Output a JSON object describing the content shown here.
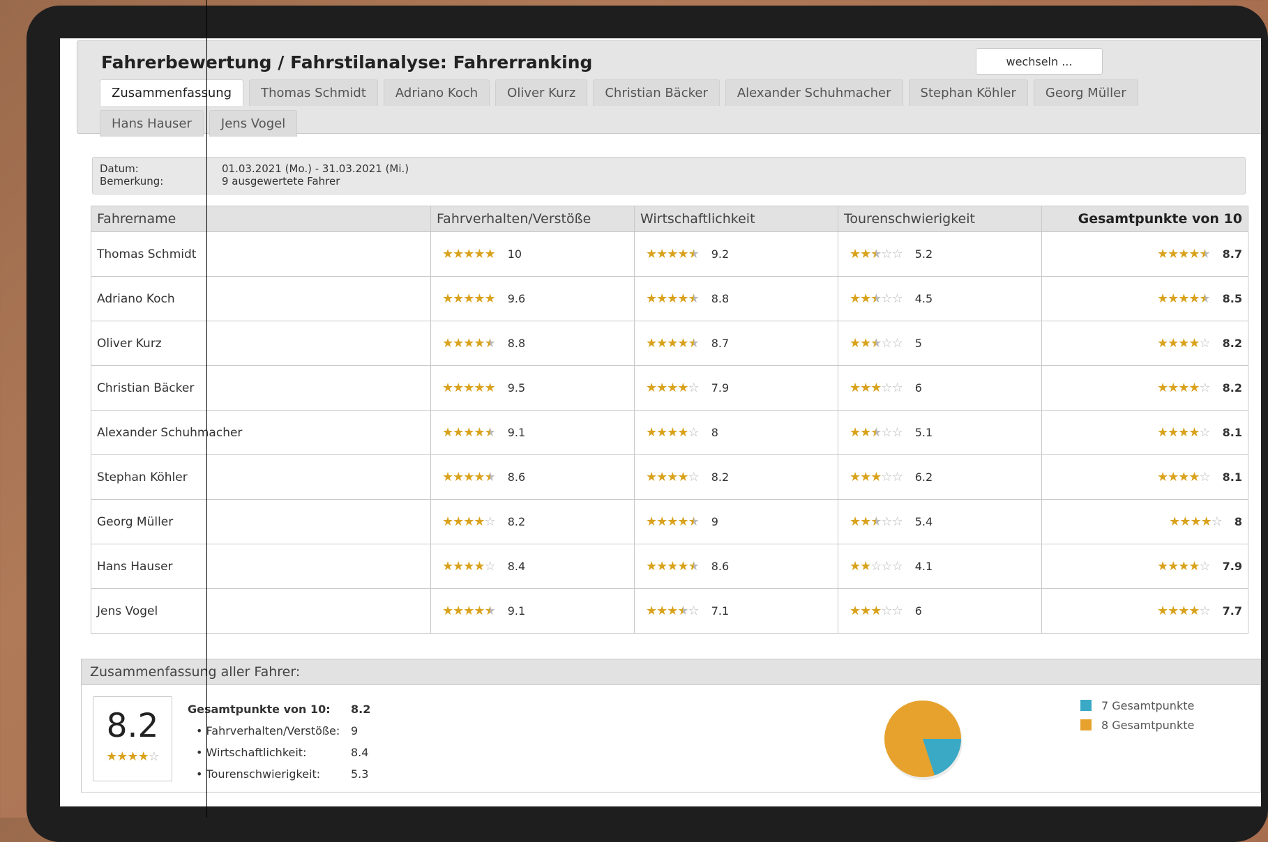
{
  "app": {
    "title": "Fahrerbewertung / Fahrstilanalyse: Fahrerranking",
    "switch_label": "wechseln ..."
  },
  "tabs": [
    {
      "label": "Zusammenfassung",
      "active": true
    },
    {
      "label": "Thomas Schmidt"
    },
    {
      "label": "Adriano Koch"
    },
    {
      "label": "Oliver Kurz"
    },
    {
      "label": "Christian Bäcker"
    },
    {
      "label": "Alexander Schuhmacher"
    },
    {
      "label": "Stephan Köhler"
    },
    {
      "label": "Georg Müller"
    },
    {
      "label": "Hans Hauser"
    },
    {
      "label": "Jens Vogel"
    }
  ],
  "info": {
    "date_label": "Datum:",
    "date_value": "01.03.2021 (Mo.) - 31.03.2021 (Mi.)",
    "note_label": "Bemerkung:",
    "note_value": "9 ausgewertete Fahrer"
  },
  "table": {
    "headers": [
      "Fahrername",
      "Fahrverhalten/Verstöße",
      "Wirtschaftlichkeit",
      "Tourenschwierigkeit",
      "Gesamtpunkte von 10"
    ],
    "rows": [
      {
        "name": "Thomas Schmidt",
        "fahrverhalten": "10",
        "fahrverhalten_stars": 5,
        "wirtschaft": "9.2",
        "wirtschaft_stars": 4.5,
        "touren": "5.2",
        "touren_stars": 2.5,
        "gesamt": "8.7",
        "gesamt_stars": 4.5
      },
      {
        "name": "Adriano Koch",
        "fahrverhalten": "9.6",
        "fahrverhalten_stars": 5,
        "wirtschaft": "8.8",
        "wirtschaft_stars": 4.5,
        "touren": "4.5",
        "touren_stars": 2.5,
        "gesamt": "8.5",
        "gesamt_stars": 4.5
      },
      {
        "name": "Oliver Kurz",
        "fahrverhalten": "8.8",
        "fahrverhalten_stars": 4.5,
        "wirtschaft": "8.7",
        "wirtschaft_stars": 4.5,
        "touren": "5",
        "touren_stars": 2.5,
        "gesamt": "8.2",
        "gesamt_stars": 4
      },
      {
        "name": "Christian Bäcker",
        "fahrverhalten": "9.5",
        "fahrverhalten_stars": 5,
        "wirtschaft": "7.9",
        "wirtschaft_stars": 4,
        "touren": "6",
        "touren_stars": 3,
        "gesamt": "8.2",
        "gesamt_stars": 4
      },
      {
        "name": "Alexander Schuhmacher",
        "fahrverhalten": "9.1",
        "fahrverhalten_stars": 4.5,
        "wirtschaft": "8",
        "wirtschaft_stars": 4,
        "touren": "5.1",
        "touren_stars": 2.5,
        "gesamt": "8.1",
        "gesamt_stars": 4
      },
      {
        "name": "Stephan Köhler",
        "fahrverhalten": "8.6",
        "fahrverhalten_stars": 4.5,
        "wirtschaft": "8.2",
        "wirtschaft_stars": 4,
        "touren": "6.2",
        "touren_stars": 3,
        "gesamt": "8.1",
        "gesamt_stars": 4
      },
      {
        "name": "Georg Müller",
        "fahrverhalten": "8.2",
        "fahrverhalten_stars": 4,
        "wirtschaft": "9",
        "wirtschaft_stars": 4.5,
        "touren": "5.4",
        "touren_stars": 2.5,
        "gesamt": "8",
        "gesamt_stars": 4
      },
      {
        "name": "Hans Hauser",
        "fahrverhalten": "8.4",
        "fahrverhalten_stars": 4,
        "wirtschaft": "8.6",
        "wirtschaft_stars": 4.5,
        "touren": "4.1",
        "touren_stars": 2,
        "gesamt": "7.9",
        "gesamt_stars": 4
      },
      {
        "name": "Jens Vogel",
        "fahrverhalten": "9.1",
        "fahrverhalten_stars": 4.5,
        "wirtschaft": "7.1",
        "wirtschaft_stars": 3.5,
        "touren": "6",
        "touren_stars": 3,
        "gesamt": "7.7",
        "gesamt_stars": 4
      }
    ]
  },
  "summary": {
    "title": "Zusammenfassung aller Fahrer:",
    "big_score": "8.2",
    "big_stars": 4,
    "lines": [
      {
        "label": "Gesamtpunkte von 10:",
        "value": "8.2"
      },
      {
        "label": "• Fahrverhalten/Verstöße:",
        "value": "9"
      },
      {
        "label": "• Wirtschaftlichkeit:",
        "value": "8.4"
      },
      {
        "label": "• Tourenschwierigkeit:",
        "value": "5.3"
      }
    ],
    "legend": [
      {
        "label": "7 Gesamtpunkte",
        "color": "#3aa9c6",
        "share": 0.2
      },
      {
        "label": "8 Gesamtpunkte",
        "color": "#e6a22c",
        "share": 0.8
      }
    ]
  },
  "colors": {
    "star": "#d9a21c",
    "star_empty": "#b9b9b9"
  }
}
